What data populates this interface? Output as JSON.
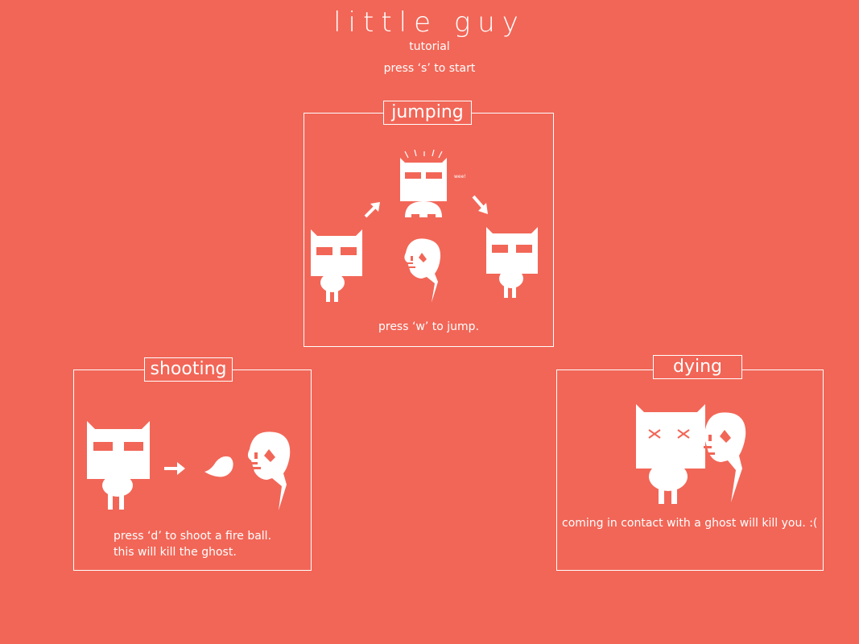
{
  "header": {
    "title": "little guy",
    "subtitle": "tutorial",
    "start_hint": "press ‘s’ to start"
  },
  "panels": {
    "jumping": {
      "title": "jumping",
      "sound_text": "wee!",
      "caption": "press ‘w’ to jump."
    },
    "shooting": {
      "title": "shooting",
      "caption_line1": "press ‘d’ to shoot a fire ball.",
      "caption_line2": "this will kill the ghost."
    },
    "dying": {
      "title": "dying",
      "caption": "coming in contact with a ghost will kill you. :("
    }
  },
  "colors": {
    "background": "#f26657",
    "foreground": "#ffffff"
  }
}
